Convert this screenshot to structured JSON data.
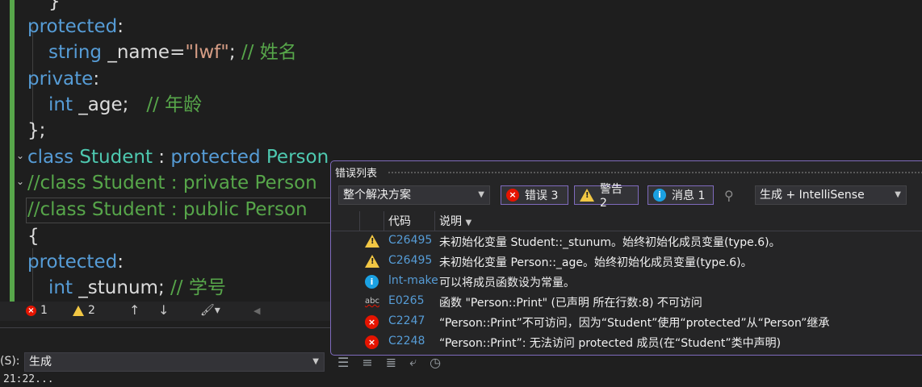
{
  "editor": {
    "line1": "}",
    "line2_kw": "protected",
    "line2_punct": ":",
    "line3_type": "string",
    "line3_name": " _name",
    "line3_eq": "=",
    "line3_str": "\"lwf\"",
    "line3_semi": ";",
    "line3_comment": " // 姓名",
    "line4_kw": "private",
    "line4_punct": ":",
    "line5_type": "int",
    "line5_name": " _age;",
    "line5_comment": "   // 年龄",
    "line6": "};",
    "line7_kw": "class",
    "line7_cls": "Student",
    "line7_colon": " : ",
    "line7_kw2": "protected",
    "line7_base": "Person",
    "line8": "//class Student : private Person",
    "line9": "//class Student : public Person",
    "line10": "{",
    "line11_kw": "protected",
    "line11_punct": ":",
    "line12_type": "int",
    "line12_name": " _stunum;",
    "line12_comment": " // 学号"
  },
  "statusbar": {
    "errors": "1",
    "warnings": "2",
    "up": "↑",
    "down": "↓",
    "left": "◀"
  },
  "output": {
    "label": "(S):",
    "source": "生成",
    "text": "21:22..."
  },
  "error_list": {
    "title": "错误列表",
    "scope": "整个解决方案",
    "errors_label": "错误 3",
    "warnings_label": "警告 2",
    "messages_label": "消息 1",
    "build_filter": "生成 + IntelliSense",
    "col_code": "代码",
    "col_desc": "说明",
    "rows": [
      {
        "code": "C26495",
        "desc": "未初始化变量 Student::_stunum。始终初始化成员变量(type.6)。"
      },
      {
        "code": "C26495",
        "desc": "未初始化变量 Person::_age。始终初始化成员变量(type.6)。"
      },
      {
        "code": "lnt-make",
        "desc": "可以将成员函数设为常量。"
      },
      {
        "code": "E0265",
        "desc": "函数 \"Person::Print\" (已声明 所在行数:8) 不可访问"
      },
      {
        "code": "C2247",
        "desc": "“Person::Print”不可访问，因为“Student”使用“protected”从“Person”继承"
      },
      {
        "code": "C2248",
        "desc": "“Person::Print”: 无法访问 protected 成员(在“Student”类中声明)"
      }
    ]
  },
  "colors": {
    "keyword": "#569cd6",
    "type": "#4ec9b0",
    "string": "#d69d85",
    "comment": "#57a64a",
    "error": "#e51400",
    "warning": "#f2c744",
    "info": "#1ba1e2",
    "accent": "#7f6bbd"
  }
}
